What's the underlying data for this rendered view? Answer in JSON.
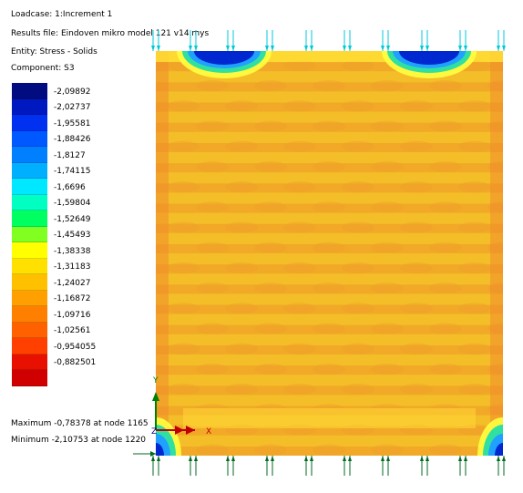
{
  "header": {
    "loadcase": "Loadcase: 1:Increment 1",
    "results_file": "Results file: Eindoven mikro model 121 v14.mys",
    "entity": "Entity: Stress - Solids",
    "component": "Component: S3"
  },
  "legend": {
    "bands": [
      {
        "color": "#000c80",
        "label": "-2,09892"
      },
      {
        "color": "#0018c0",
        "label": "-2,02737"
      },
      {
        "color": "#0030f0",
        "label": "-1,95581"
      },
      {
        "color": "#0058ff",
        "label": "-1,88426"
      },
      {
        "color": "#0080ff",
        "label": "-1,8127"
      },
      {
        "color": "#00b0ff",
        "label": "-1,74115"
      },
      {
        "color": "#00e8ff",
        "label": "-1,6696"
      },
      {
        "color": "#00ffc0",
        "label": "-1,59804"
      },
      {
        "color": "#00ff60",
        "label": "-1,52649"
      },
      {
        "color": "#80ff20",
        "label": "-1,45493"
      },
      {
        "color": "#ffff00",
        "label": "-1,38338"
      },
      {
        "color": "#ffe000",
        "label": "-1,31183"
      },
      {
        "color": "#ffc000",
        "label": "-1,24027"
      },
      {
        "color": "#ffa000",
        "label": "-1,16872"
      },
      {
        "color": "#ff8000",
        "label": "-1,09716"
      },
      {
        "color": "#ff6000",
        "label": "-1,02561"
      },
      {
        "color": "#ff4000",
        "label": "-0,954055"
      },
      {
        "color": "#e81000",
        "label": "-0,882501"
      },
      {
        "color": "#d00000",
        "label": ""
      }
    ]
  },
  "summary": {
    "maximum": "Maximum -0,78378 at node 1165",
    "minimum": "Minimum -2,10753 at node 1220"
  },
  "axes": {
    "y_label": "Y",
    "x_label": "X",
    "z_label": "Z"
  },
  "colors": {
    "base": "#f2b126",
    "row_light": "#f6c82a",
    "row_dark": "#f0a02a",
    "edge": "#f08c2a",
    "hot_blue": "#0028d0",
    "load_top": "#00c8d8",
    "load_bottom": "#006a20",
    "axis_green": "#008000",
    "axis_red": "#c00000"
  }
}
